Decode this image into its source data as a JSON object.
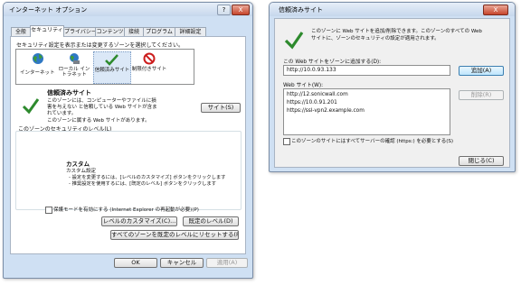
{
  "inet": {
    "title": "インターネット オプション",
    "help_btn": "?",
    "close_btn": "X",
    "tabs": [
      "全般",
      "セキュリティ",
      "プライバシー",
      "コンテンツ",
      "接続",
      "プログラム",
      "詳細設定"
    ],
    "zone_prompt": "セキュリティ設定を表示または変更するゾーンを選択してください。",
    "zones": [
      {
        "label": "インターネット",
        "icon": "globe-icon"
      },
      {
        "label": "ローカル イントラネット",
        "icon": "intranet-icon"
      },
      {
        "label": "信頼済みサイト",
        "icon": "check-icon"
      },
      {
        "label": "制限付きサイト",
        "icon": "restricted-icon"
      }
    ],
    "zone_title": "信頼済みサイト",
    "zone_desc": "このゾーンには、コンピューターやファイルに損害を与えない と信頼している Web サイトが含まれています。",
    "sites_button": "サイト(S)",
    "zone_has_sites": "このゾーンに属する Web サイトがあります。",
    "level_label": "このゾーンのセキュリティのレベル(L)",
    "custom_title": "カスタム",
    "custom_line1": "カスタム設定",
    "custom_line2": "- 設定を変更するには、[レベルのカスタマイズ] ボタンをクリックします",
    "custom_line3": "- 推奨設定を使用するには、[既定のレベル] ボタンをクリックします",
    "protected_mode": "保護モードを有効にする (Internet Explorer の再起動が必要)(P)",
    "custom_level_btn": "レベルのカスタマイズ(C)...",
    "default_level_btn": "既定のレベル(D)",
    "reset_all_btn": "すべてのゾーンを既定のレベルにリセットする(R)",
    "ok": "OK",
    "cancel": "キャンセル",
    "apply": "適用(A)"
  },
  "trusted": {
    "title": "信頼済みサイト",
    "close_btn": "X",
    "desc1": "このゾーンに Web サイトを追加/削除できます。このゾーンのすべての Web",
    "desc2": "サイトに、ゾーンのセキュリティの設定が適用されます。",
    "add_label": "この Web サイトをゾーンに追加する(D):",
    "add_value": "http://10.0.93.133",
    "add_btn": "追加(A)",
    "list_label": "Web サイト(W):",
    "sites": [
      "http://12.sonicwall.com",
      "https://10.0.91.201",
      "https://ssl-vpn2.example.com"
    ],
    "remove_btn": "削除(R)",
    "https_check": "このゾーンのサイトにはすべてサーバーの確認 (https:) を必要とする(S)",
    "close_dialog_btn": "閉じる(C)"
  },
  "colors": {
    "accent": "#2d8a2d",
    "restricted": "#cc1d1d"
  }
}
